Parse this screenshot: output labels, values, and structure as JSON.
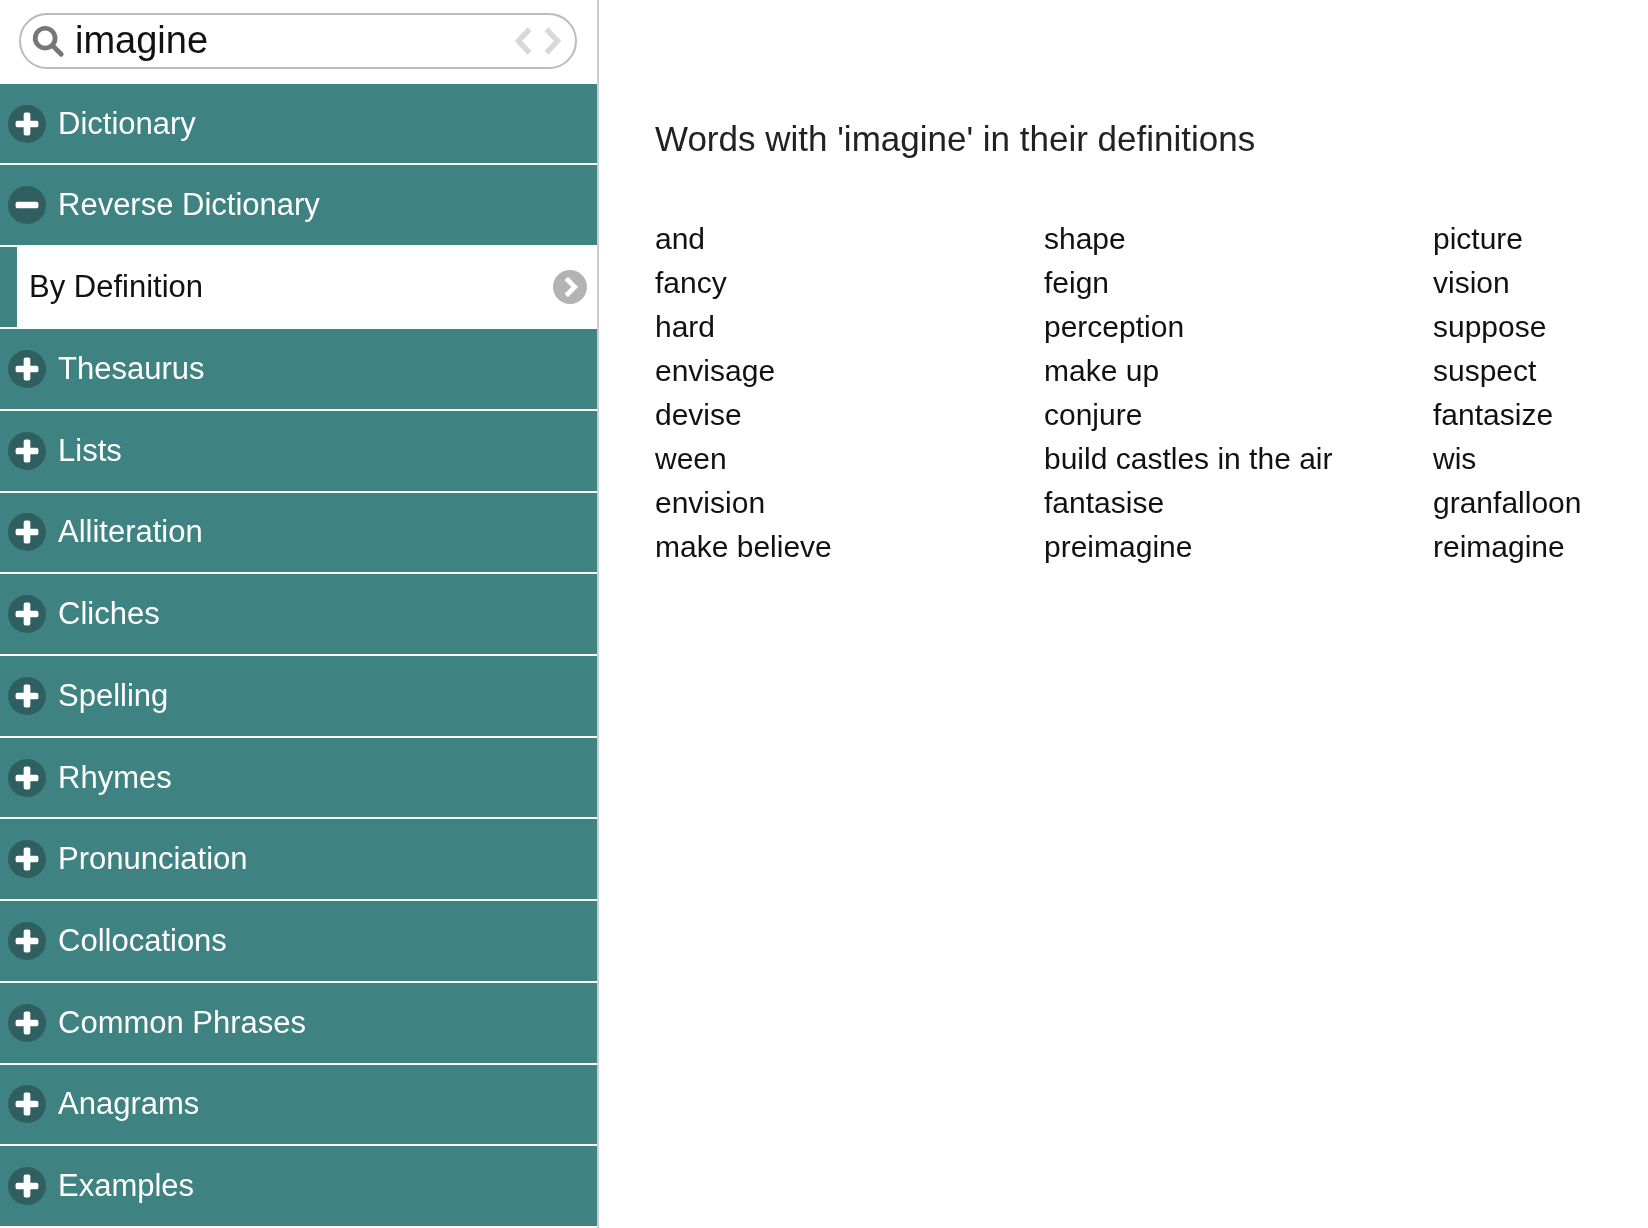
{
  "search": {
    "value": "imagine"
  },
  "sidebar": {
    "sections": [
      {
        "label": "Dictionary",
        "expanded": false
      },
      {
        "label": "Reverse Dictionary",
        "expanded": true,
        "children": [
          {
            "label": "By Definition",
            "selected": true
          }
        ]
      },
      {
        "label": "Thesaurus",
        "expanded": false
      },
      {
        "label": "Lists",
        "expanded": false
      },
      {
        "label": "Alliteration",
        "expanded": false
      },
      {
        "label": "Cliches",
        "expanded": false
      },
      {
        "label": "Spelling",
        "expanded": false
      },
      {
        "label": "Rhymes",
        "expanded": false
      },
      {
        "label": "Pronunciation",
        "expanded": false
      },
      {
        "label": "Collocations",
        "expanded": false
      },
      {
        "label": "Common Phrases",
        "expanded": false
      },
      {
        "label": "Anagrams",
        "expanded": false
      },
      {
        "label": "Examples",
        "expanded": false
      }
    ]
  },
  "content": {
    "heading": "Words with 'imagine' in their definitions",
    "word_columns": [
      [
        "and",
        "fancy",
        "hard",
        "envisage",
        "devise",
        "ween",
        "envision",
        "make believe"
      ],
      [
        "shape",
        "feign",
        "perception",
        "make up",
        "conjure",
        "build castles in the air",
        "fantasise",
        "preimagine"
      ],
      [
        "picture",
        "vision",
        "suppose",
        "suspect",
        "fantasize",
        "wis",
        "granfalloon",
        "reimagine"
      ]
    ]
  }
}
